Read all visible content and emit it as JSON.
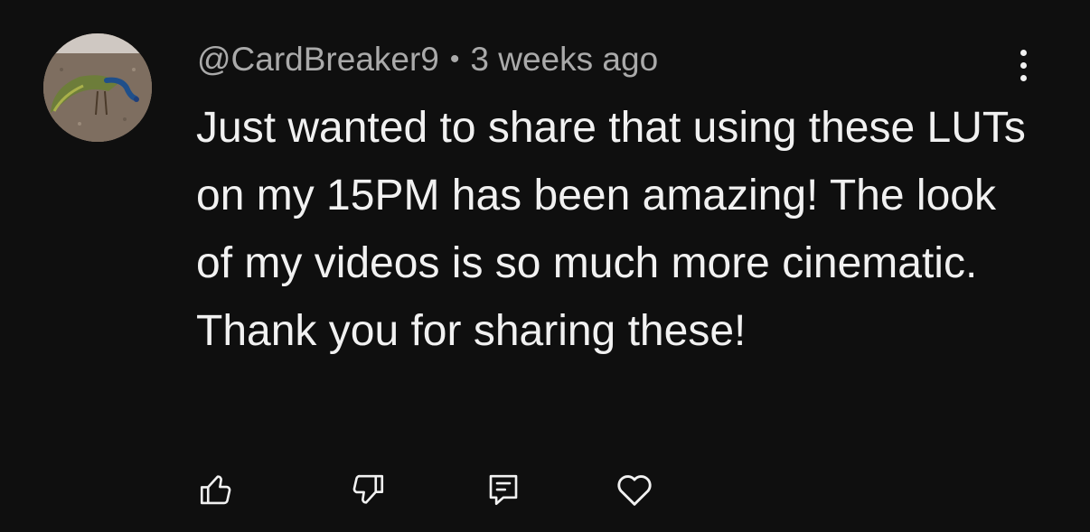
{
  "comment": {
    "author": "@CardBreaker9",
    "separator": "•",
    "timestamp": "3 weeks ago",
    "text": "Just wanted to share that using these LUTs on my 15PM has been amazing! The look of my videos is so much more cinematic. Thank you for sharing these!",
    "avatar": {
      "description_icon": "peacock-avatar"
    }
  },
  "actions": {
    "like_icon": "thumbs-up-icon",
    "dislike_icon": "thumbs-down-icon",
    "reply_icon": "reply-icon",
    "heart_icon": "heart-icon",
    "more_icon": "more-vertical-icon"
  },
  "colors": {
    "background": "#0f0f0f",
    "text_primary": "#f1f1f1",
    "text_secondary": "#aaaaaa"
  }
}
